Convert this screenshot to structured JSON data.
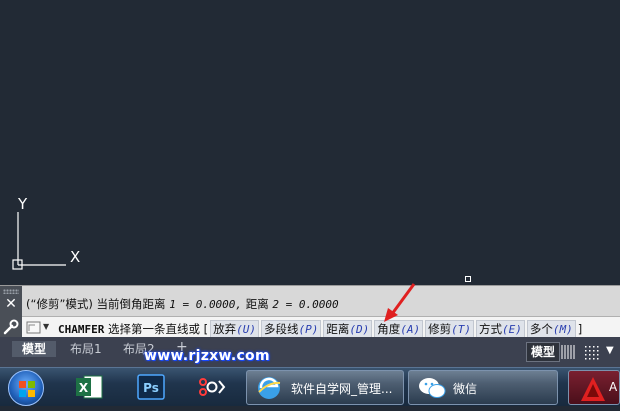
{
  "canvas": {
    "background": "#222a35",
    "ucs": {
      "y_label": "Y",
      "x_label": "X"
    }
  },
  "command_panel": {
    "history": {
      "mode": "(“修剪”模式) 当前倒角距离",
      "d1_label": "1 = 0.0000,",
      "d2_prefix": "距离",
      "d2_label": "2 = 0.0000"
    },
    "input": {
      "command": "CHAMFER",
      "prompt": "选择第一条直线或",
      "open_bracket": "[",
      "close_bracket": "]",
      "options": [
        {
          "text": "放弃",
          "key": "(U)"
        },
        {
          "text": "多段线",
          "key": "(P)"
        },
        {
          "text": "距离",
          "key": "(D)"
        },
        {
          "text": "角度",
          "key": "(A)"
        },
        {
          "text": "修剪",
          "key": "(T)"
        },
        {
          "text": "方式",
          "key": "(E)"
        },
        {
          "text": "多个",
          "key": "(M)"
        }
      ]
    }
  },
  "layout_tabs": {
    "tabs": [
      "模型",
      "布局1",
      "布局2"
    ],
    "add": "+",
    "watermark": "www.rjzxw.com"
  },
  "status_bar": {
    "model": "模型"
  },
  "taskbar": {
    "buttons": [
      {
        "label": "软件自学网_管理..."
      },
      {
        "label": "微信"
      },
      {
        "label": "A"
      }
    ]
  },
  "colors": {
    "accent_arrow": "#e02020",
    "option_key": "#2a3fb0"
  }
}
